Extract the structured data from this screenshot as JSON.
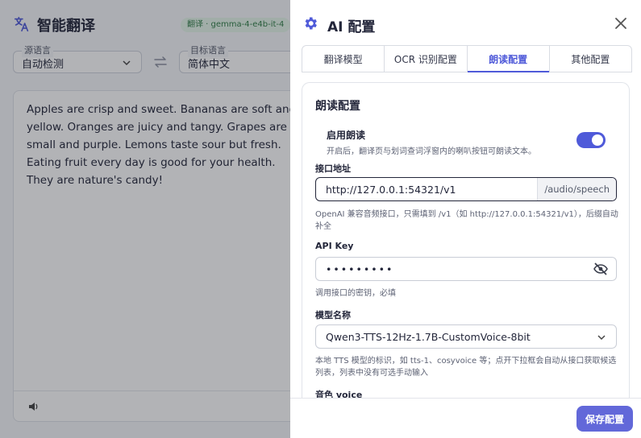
{
  "app": {
    "title": "智能翻译",
    "model_badge": "翻译 · gemma-4-e4b-it-4",
    "source_lang": {
      "legend": "源语言",
      "value": "自动检测"
    },
    "target_lang": {
      "legend": "目标语言",
      "value": "简体中文"
    },
    "source_text": "Apples are crisp and sweet. Bananas are soft and yellow. Oranges are juicy and tangy. Grapes are small and purple. Lemons taste sour but fresh. Eating fruit every day is good for your health. They are nature's candy!"
  },
  "drawer": {
    "title": "AI 配置",
    "tabs": [
      {
        "label": "翻译模型",
        "active": false
      },
      {
        "label": "OCR 识别配置",
        "active": false
      },
      {
        "label": "朗读配置",
        "active": true
      },
      {
        "label": "其他配置",
        "active": false
      }
    ],
    "section_title": "朗读配置",
    "enable": {
      "label": "启用朗读",
      "hint": "开启后，翻译页与划词查词浮窗内的喇叭按钮可朗读文本。",
      "on": true
    },
    "endpoint": {
      "label": "接口地址",
      "value": "http://127.0.0.1:54321/v1",
      "suffix": "/audio/speech",
      "hint": "OpenAI 兼容音频接口，只需填到 /v1（如 http://127.0.0.1:54321/v1），后缀自动补全"
    },
    "api_key": {
      "label": "API Key",
      "value": "•••••••••",
      "hint": "调用接口的密钥，必填"
    },
    "model": {
      "label": "模型名称",
      "value": "Qwen3-TTS-12Hz-1.7B-CustomVoice-8bit",
      "hint": "本地 TTS 模型的标识，如 tts-1、cosyvoice 等；点开下拉框会自动从接口获取候选列表，列表中没有可选手动输入"
    },
    "voice": {
      "label": "音色 voice"
    },
    "save_label": "保存配置"
  },
  "colors": {
    "accent": "#4f5ad9",
    "save_button": "#6268d9",
    "badge_bg": "#e6f6ea",
    "badge_text": "#2f7d46"
  }
}
